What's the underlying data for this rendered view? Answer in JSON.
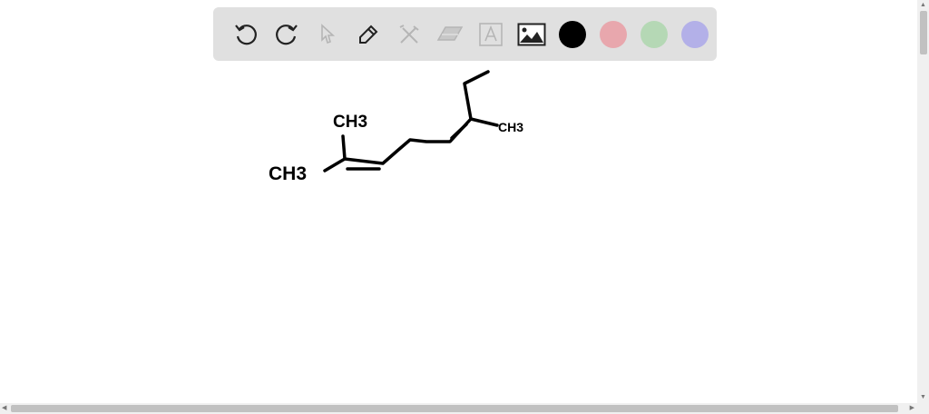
{
  "toolbar": {
    "tools": [
      {
        "name": "undo",
        "icon": "undo-icon",
        "enabled": true
      },
      {
        "name": "redo",
        "icon": "redo-icon",
        "enabled": true
      },
      {
        "name": "select",
        "icon": "cursor-icon",
        "enabled": false
      },
      {
        "name": "pen",
        "icon": "pencil-icon",
        "enabled": true
      },
      {
        "name": "tools",
        "icon": "tools-icon",
        "enabled": false
      },
      {
        "name": "eraser",
        "icon": "eraser-icon",
        "enabled": false
      },
      {
        "name": "text",
        "icon": "text-icon",
        "enabled": false
      },
      {
        "name": "image",
        "icon": "image-icon",
        "enabled": true
      }
    ],
    "colors": [
      "#000000",
      "#e8a7ad",
      "#b5d8b5",
      "#b3b0e8"
    ],
    "selected_color": "#000000"
  },
  "drawing": {
    "labels": {
      "top_methyl": "CH3",
      "left_methyl": "CH3",
      "right_methyl": "CH3"
    }
  }
}
